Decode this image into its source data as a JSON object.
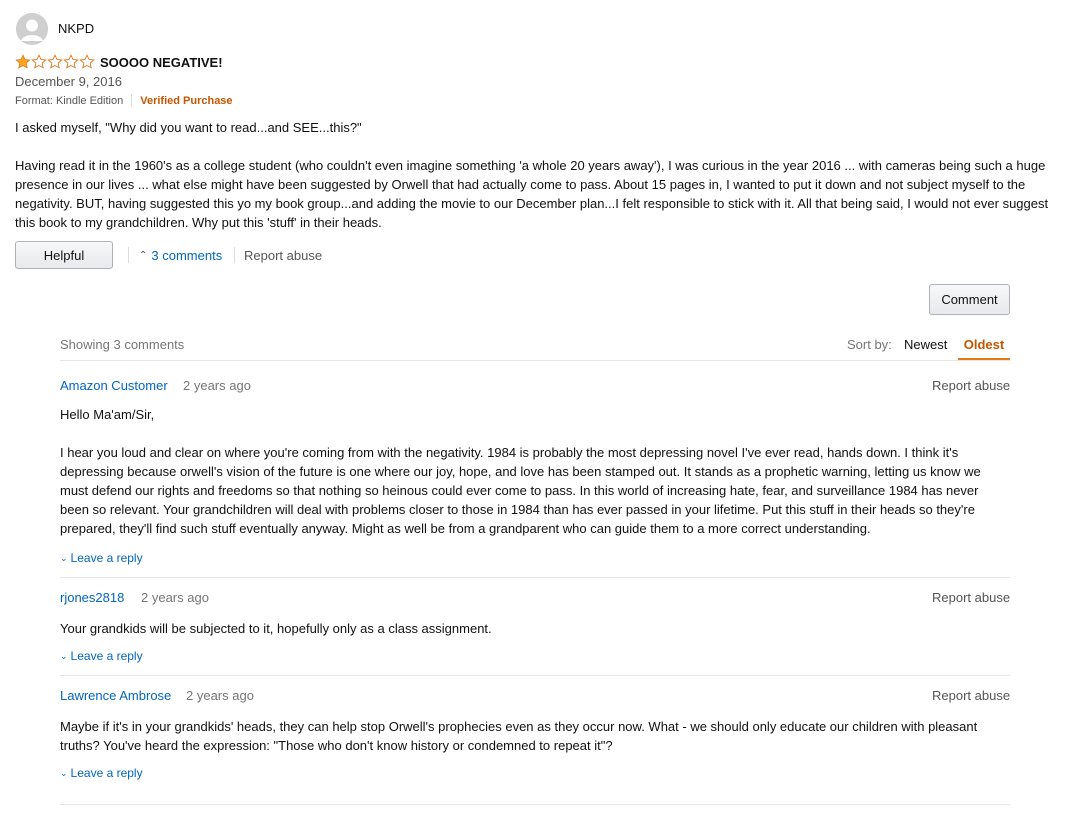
{
  "review": {
    "reviewer": "NKPD",
    "rating": 1,
    "max_rating": 5,
    "title": "SOOOO NEGATIVE!",
    "date": "December 9, 2016",
    "format": "Format: Kindle Edition",
    "verified": "Verified Purchase",
    "body": [
      "I asked myself, \"Why did you want to read...and SEE...this?\"",
      "Having read it in the 1960's as a college student (who couldn't even imagine something 'a whole 20 years away'), I was curious in the year 2016 ... with cameras being such a huge presence in our lives ... what else might have been suggested by Orwell that had actually come to pass. About 15 pages in, I wanted to put it down and not subject myself to the negativity. BUT, having suggested this yo my book group...and adding the movie to our December plan...I felt responsible to stick with it. All that being said, I would not ever suggest this book to my grandchildren. Why put this 'stuff' in their heads."
    ],
    "helpful_label": "Helpful",
    "comments_link": "3 comments",
    "report_label": "Report abuse"
  },
  "comment_button": "Comment",
  "comments_header": {
    "showing": "Showing 3 comments",
    "sort_label": "Sort by:",
    "sort_newest": "Newest",
    "sort_oldest": "Oldest",
    "active_sort": "Oldest"
  },
  "comments": [
    {
      "author": "Amazon Customer",
      "time": "2 years ago",
      "report": "Report abuse",
      "body": [
        "Hello Ma'am/Sir,",
        "I hear you loud and clear on where you're coming from with the negativity. 1984 is probably the most depressing novel I've ever read, hands down. I think it's depressing because orwell's vision of the future is one where our joy, hope, and love has been stamped out. It stands as a prophetic warning, letting us know we must defend our rights and freedoms so that nothing so heinous could ever come to pass. In this world of increasing hate, fear, and surveillance 1984 has never been so relevant. Your grandchildren will deal with problems closer to those in 1984 than has ever passed in your lifetime. Put this stuff in their heads so they're prepared, they'll find such stuff eventually anyway. Might as well be from a grandparent who can guide them to a more correct understanding."
      ],
      "reply": "Leave a reply"
    },
    {
      "author": "rjones2818",
      "time": "2 years ago",
      "report": "Report abuse",
      "body": [
        "Your grandkids will be subjected to it, hopefully only as a class assignment."
      ],
      "reply": "Leave a reply"
    },
    {
      "author": "Lawrence Ambrose",
      "time": "2 years ago",
      "report": "Report abuse",
      "body": [
        "Maybe if it's in your grandkids' heads, they can help stop Orwell's prophecies even as they occur now. What - we should only educate our children with pleasant truths? You've heard the expression: \"Those who don't know history or condemned to repeat it\"?"
      ],
      "reply": "Leave a reply"
    }
  ],
  "colors": {
    "link": "#0066c0",
    "verified": "#c45500",
    "active_sort": "#c45500",
    "sort_underline": "#e47911",
    "star_fill": "#ffa41c",
    "star_outline": "#de7921"
  },
  "icons": {
    "avatar": "user-avatar-icon",
    "star_full": "star-filled-icon",
    "star_empty": "star-empty-icon",
    "expand": "chevron-up-icon",
    "reply": "chevron-down-icon"
  }
}
